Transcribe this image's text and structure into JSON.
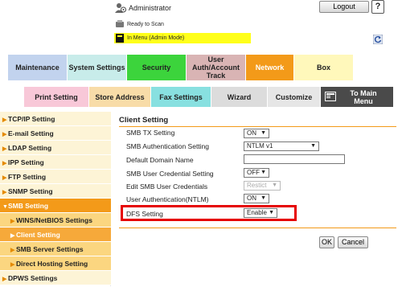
{
  "header": {
    "user_label": "Administrator",
    "logout_label": "Logout",
    "help_label": "?",
    "status_text": "Ready to Scan",
    "mode_text": "In Menu (Admin Mode)"
  },
  "tabs_row1": [
    {
      "label": "Maintenance",
      "color": "#c2d3ee"
    },
    {
      "label": "System Settings",
      "color": "#c8ecea"
    },
    {
      "label": "Security",
      "color": "#3cd43c"
    },
    {
      "label": "User\nAuth/Account\nTrack",
      "color": "#d9b4b4"
    },
    {
      "label": "Network",
      "color": "#f39a19"
    },
    {
      "label": "Box",
      "color": "#fff8bb"
    }
  ],
  "tabs_row2": [
    {
      "label": "Print Setting",
      "color": "#f8c8d8"
    },
    {
      "label": "Store Address",
      "color": "#f8dca8"
    },
    {
      "label": "Fax Settings",
      "color": "#88e0e0"
    },
    {
      "label": "Wizard",
      "color": "#dcdcdc"
    },
    {
      "label": "Customize",
      "color": "#e6e6e6"
    },
    {
      "label": "To Main\nMenu",
      "color": "#4a4a4a"
    }
  ],
  "sidebar": {
    "items": [
      {
        "label": "TCP/IP Setting",
        "arrow": "▶"
      },
      {
        "label": "E-mail Setting",
        "arrow": "▶"
      },
      {
        "label": "LDAP Setting",
        "arrow": "▶"
      },
      {
        "label": "IPP Setting",
        "arrow": "▶"
      },
      {
        "label": "FTP Setting",
        "arrow": "▶"
      },
      {
        "label": "SNMP Setting",
        "arrow": "▶"
      },
      {
        "label": "SMB Setting",
        "arrow": "▼"
      },
      {
        "label": "WINS/NetBIOS Settings",
        "arrow": "▶"
      },
      {
        "label": "Client Setting",
        "arrow": "▶"
      },
      {
        "label": "SMB Server Settings",
        "arrow": "▶"
      },
      {
        "label": "Direct Hosting Setting",
        "arrow": "▶"
      },
      {
        "label": "DPWS Settings",
        "arrow": "▶"
      }
    ]
  },
  "main": {
    "title": "Client Setting",
    "rows": [
      {
        "label": "SMB TX Setting",
        "value": "ON"
      },
      {
        "label": "SMB Authentication Setting",
        "value": "NTLM v1"
      },
      {
        "label": "Default Domain Name",
        "value": ""
      },
      {
        "label": "SMB User Credential Setting",
        "value": "OFF"
      },
      {
        "label": "Edit SMB User Credentials",
        "value": "Restict"
      },
      {
        "label": "User Authentication(NTLM)",
        "value": "ON"
      },
      {
        "label": "DFS Setting",
        "value": "Enable"
      }
    ],
    "ok_label": "OK",
    "cancel_label": "Cancel"
  }
}
